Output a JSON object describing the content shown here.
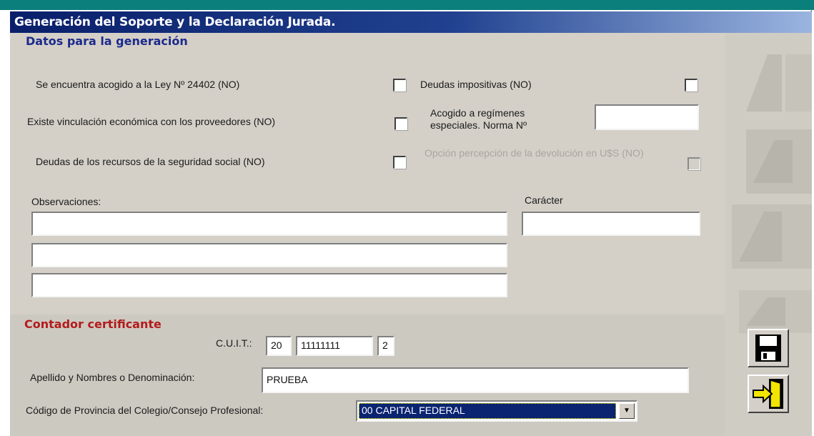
{
  "window": {
    "title": "Generación del Soporte y la Declaración Jurada."
  },
  "sections": {
    "datos": "Datos para la generación",
    "contador": "Contador certificante"
  },
  "checkboxes": {
    "ley_24402": {
      "label": "Se encuentra acogido a la Ley Nº 24402 (NO)",
      "checked": false
    },
    "deudas_impositivas": {
      "label": "Deudas impositivas (NO)",
      "checked": false
    },
    "vinculacion": {
      "label": "Existe vinculación económica con los proveedores (NO)",
      "checked": false
    },
    "deudas_seguridad": {
      "label": "Deudas de los recursos de la seguridad social (NO)",
      "checked": false
    },
    "opcion_percepcion": {
      "label": "Opción percepción de la devolución en U$S (NO)",
      "checked": false,
      "disabled": true
    }
  },
  "regimenes": {
    "label": "Acogido a regímenes especiales. Norma Nº",
    "value": ""
  },
  "observaciones": {
    "label": "Observaciones:",
    "lines": [
      "",
      "",
      ""
    ]
  },
  "caracter": {
    "label": "Carácter",
    "value": ""
  },
  "cuit": {
    "label": "C.U.I.T.:",
    "part1": "20",
    "part2": "11111111",
    "part3": "2"
  },
  "apellido": {
    "label": "Apellido y Nombres o Denominación:",
    "value": "PRUEBA"
  },
  "provincia": {
    "label": "Código de Provincia del Colegio/Consejo Profesional:",
    "selected": "00 CAPITAL FEDERAL"
  },
  "buttons": {
    "save_icon": "floppy-disk-icon",
    "exit_icon": "exit-door-icon"
  },
  "colors": {
    "section_datos": "#1c2a8c",
    "section_contador": "#b31b1b",
    "selection": "#0a2472"
  }
}
